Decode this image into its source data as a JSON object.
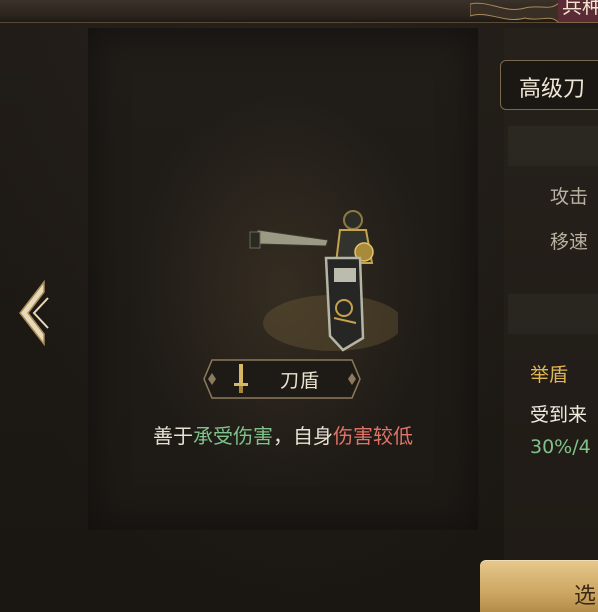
{
  "header": {
    "tab_label": "兵种"
  },
  "preview": {
    "unit_name": "刀盾",
    "unit_icon": "sword-icon",
    "description": {
      "part1": "善于",
      "good_trait": "承受伤害",
      "part2": "，自身",
      "bad_trait": "伤害较低"
    }
  },
  "details": {
    "title": "高级刀",
    "stats": [
      {
        "label": "攻击"
      },
      {
        "label": "移速"
      }
    ],
    "skill": {
      "name": "举盾",
      "description": "受到来",
      "value": "30%/4"
    }
  },
  "actions": {
    "select_label": "选"
  },
  "colors": {
    "good": "#7fc38a",
    "bad": "#e17468",
    "skill_title": "#e0b656",
    "gold": "#c9a25e"
  }
}
